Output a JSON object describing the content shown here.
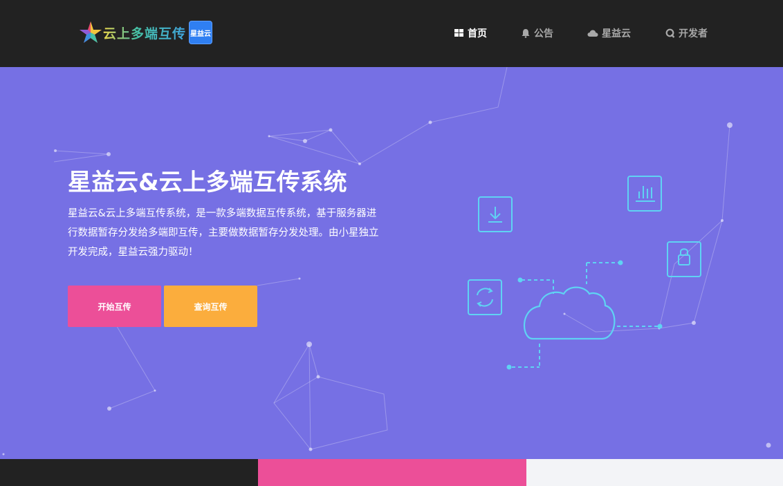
{
  "header": {
    "logo_text": "云上多端互传",
    "logo_badge": "星益云",
    "nav": [
      {
        "label": "首页",
        "icon": "grid-icon",
        "active": true
      },
      {
        "label": "公告",
        "icon": "bell-icon",
        "active": false
      },
      {
        "label": "星益云",
        "icon": "cloud-icon",
        "active": false
      },
      {
        "label": "开发者",
        "icon": "q-icon",
        "active": false
      }
    ]
  },
  "hero": {
    "title": "星益云&云上多端互传系统",
    "description": "星益云&云上多端互传系统，是一款多端数据互传系统，基于服务器进行数据暂存分发给多端即互传，主要做数据暂存分发处理。由小星独立开发完成，星益云强力驱动！",
    "buttons": {
      "start": "开始互传",
      "query": "查询互传"
    }
  },
  "colors": {
    "topbar": "#222222",
    "hero_bg": "#7670e4",
    "start_button": "#ec4f98",
    "query_button": "#fbad3d",
    "illustration_line": "#5fd3f3"
  }
}
